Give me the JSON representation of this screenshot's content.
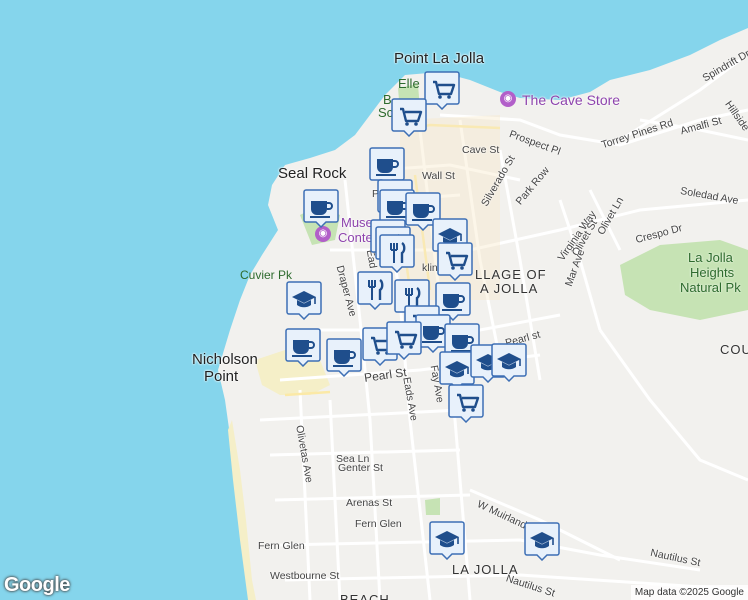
{
  "map": {
    "labels": {
      "point_la_jolla": "Point La Jolla",
      "seal_rock": "Seal Rock",
      "nicholson_point_1": "Nicholson",
      "nicholson_point_2": "Point",
      "cuvier_pk": "Cuvier Pk",
      "the_cave_store": "The Cave Store",
      "museum_1": "Muse",
      "museum_2": "Conte",
      "village_1": "LLAGE OF",
      "village_2": "A JOLLA",
      "la_jolla": "LA JOLLA",
      "beach": "BEACH",
      "cou": "COU",
      "park_1": "La Jolla",
      "park_2": "Heights",
      "park_3": "Natural Pk",
      "elle": "Elle",
      "bs1": "B",
      "bs2": "Sc"
    },
    "streets": {
      "prospect_pl": "Prospect Pl",
      "torrey_pines_rd": "Torrey Pines Rd",
      "cave_st": "Cave St",
      "wall_st": "Wall St",
      "silverado_st": "Silverado St",
      "park_row": "Park Row",
      "spindrift_dr": "Spindrift Dr",
      "amalfi_st": "Amalfi St",
      "hillside": "Hillside",
      "soledad_ave": "Soledad Ave",
      "crespo_dr": "Crespo Dr",
      "virginia_way": "Virginia Way",
      "olivet_st": "Olivet St",
      "olivet_ln": "Olivet Ln",
      "mar_ave": "Mar Ave",
      "draper_ave": "Draper Ave",
      "pearl_st": "Pearl St",
      "pearl_st_2": "Pearl st",
      "eads_ave": "Eads Ave",
      "fay_ave": "Fay Ave",
      "olivetas_ave": "Olivetas Ave",
      "sea_ln": "Sea Ln",
      "genter_st": "Genter St",
      "arenas_st": "Arenas St",
      "fern_glen_1": "Fern Glen",
      "fern_glen_2": "Fern Glen",
      "westbourne_st": "Westbourne St",
      "nautilus_st": "Nautilus St",
      "nautilus_st_2": "Nautilus St",
      "w_muirlands": "W Muirlands",
      "ead": "Ead",
      "pr": "Pr",
      "klin": "klin"
    },
    "attribution": "Map data ©2025 Google",
    "logo": "Google"
  },
  "markers": [
    {
      "type": "grocery",
      "icon": "shopping-cart-icon"
    },
    {
      "type": "grocery",
      "icon": "shopping-cart-icon"
    },
    {
      "type": "cafe",
      "icon": "coffee-cup-icon"
    },
    {
      "type": "cafe",
      "icon": "coffee-cup-icon"
    },
    {
      "type": "cafe",
      "icon": "coffee-cup-icon"
    },
    {
      "type": "cafe",
      "icon": "coffee-cup-icon"
    },
    {
      "type": "cafe",
      "icon": "coffee-cup-icon"
    },
    {
      "type": "restaurant",
      "icon": "fork-knife-icon"
    },
    {
      "type": "restaurant",
      "icon": "fork-knife-icon"
    },
    {
      "type": "restaurant",
      "icon": "fork-knife-icon"
    },
    {
      "type": "school",
      "icon": "graduation-cap-icon"
    },
    {
      "type": "grocery",
      "icon": "shopping-cart-icon"
    },
    {
      "type": "school",
      "icon": "graduation-cap-icon"
    },
    {
      "type": "restaurant",
      "icon": "fork-knife-icon"
    },
    {
      "type": "restaurant",
      "icon": "fork-knife-icon"
    },
    {
      "type": "cafe",
      "icon": "coffee-cup-icon"
    },
    {
      "type": "grocery",
      "icon": "shopping-cart-icon"
    },
    {
      "type": "cafe",
      "icon": "coffee-cup-icon"
    },
    {
      "type": "cafe",
      "icon": "coffee-cup-icon"
    },
    {
      "type": "cafe",
      "icon": "coffee-cup-icon"
    },
    {
      "type": "cafe",
      "icon": "coffee-cup-icon"
    },
    {
      "type": "grocery",
      "icon": "shopping-cart-icon"
    },
    {
      "type": "grocery",
      "icon": "shopping-cart-icon"
    },
    {
      "type": "school",
      "icon": "graduation-cap-icon"
    },
    {
      "type": "school",
      "icon": "graduation-cap-icon"
    },
    {
      "type": "school",
      "icon": "graduation-cap-icon"
    },
    {
      "type": "grocery",
      "icon": "shopping-cart-icon"
    },
    {
      "type": "school",
      "icon": "graduation-cap-icon"
    },
    {
      "type": "school",
      "icon": "graduation-cap-icon"
    }
  ],
  "colors": {
    "ocean": "#85d5ec",
    "land": "#f2f1ee",
    "park": "#c6e3b4",
    "beach": "#f5efc8",
    "marker_fill": "#e8f1fb",
    "marker_border": "#3d6fb5",
    "marker_icon": "#1f4e8c",
    "poi": "#b25fc9"
  }
}
